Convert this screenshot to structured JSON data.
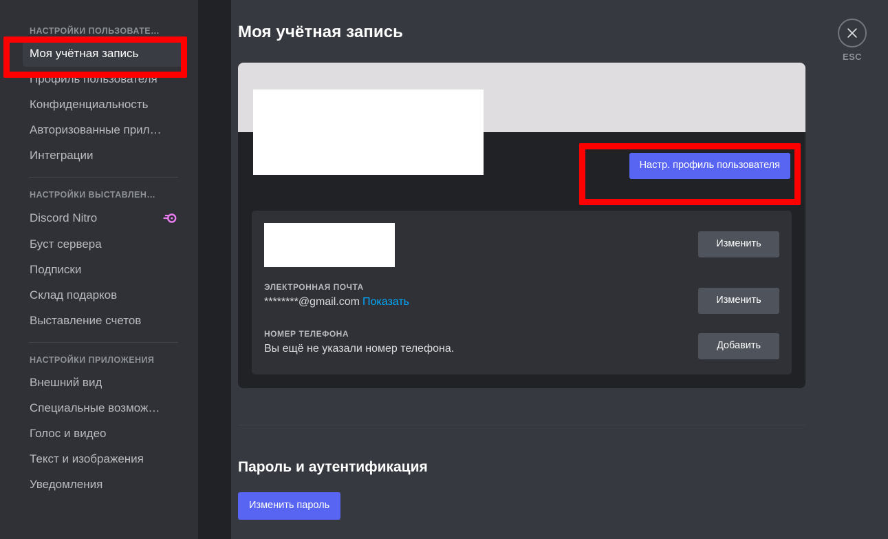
{
  "sidebar": {
    "groups": [
      {
        "header": "НАСТРОЙКИ ПОЛЬЗОВАТЕ…",
        "items": [
          {
            "label": "Моя учётная запись",
            "selected": true,
            "icon": ""
          },
          {
            "label": "Профиль пользователя",
            "selected": false,
            "icon": ""
          },
          {
            "label": "Конфиденциальность",
            "selected": false,
            "icon": ""
          },
          {
            "label": "Авторизованные прил…",
            "selected": false,
            "icon": ""
          },
          {
            "label": "Интеграции",
            "selected": false,
            "icon": ""
          }
        ]
      },
      {
        "header": "НАСТРОЙКИ ВЫСТАВЛЕН…",
        "items": [
          {
            "label": "Discord Nitro",
            "selected": false,
            "icon": "nitro-icon"
          },
          {
            "label": "Буст сервера",
            "selected": false,
            "icon": ""
          },
          {
            "label": "Подписки",
            "selected": false,
            "icon": ""
          },
          {
            "label": "Склад подарков",
            "selected": false,
            "icon": ""
          },
          {
            "label": "Выставление счетов",
            "selected": false,
            "icon": ""
          }
        ]
      },
      {
        "header": "НАСТРОЙКИ ПРИЛОЖЕНИЯ",
        "items": [
          {
            "label": "Внешний вид",
            "selected": false,
            "icon": ""
          },
          {
            "label": "Специальные возмож…",
            "selected": false,
            "icon": ""
          },
          {
            "label": "Голос и видео",
            "selected": false,
            "icon": ""
          },
          {
            "label": "Текст и изображения",
            "selected": false,
            "icon": ""
          },
          {
            "label": "Уведомления",
            "selected": false,
            "icon": ""
          }
        ]
      }
    ]
  },
  "header": {
    "title": "Моя учётная запись"
  },
  "close": {
    "icon": "close-icon",
    "label": "ESC"
  },
  "account_card": {
    "edit_profile_button": "Настр. профиль пользователя",
    "fields": [
      {
        "label": "",
        "value": "",
        "redacted": true,
        "button": "Изменить"
      },
      {
        "label": "ЭЛЕКТРОННАЯ ПОЧТА",
        "value": "********@gmail.com",
        "reveal": "Показать",
        "redacted": false,
        "button": "Изменить"
      },
      {
        "label": "НОМЕР ТЕЛЕФОНА",
        "value": "Вы ещё не указали номер телефона.",
        "redacted": false,
        "button": "Добавить"
      }
    ]
  },
  "password_section": {
    "title": "Пароль и аутентификация",
    "change_password_button": "Изменить пароль"
  },
  "colors": {
    "accent": "#5865f2",
    "link": "#00a8fc",
    "sidebar_bg": "#2f3136",
    "content_bg": "#36393f",
    "card_bg": "#202225",
    "panel_bg": "#2f3136",
    "secondary_button": "#4f545c",
    "annotation": "#ff0000",
    "nitro": "#ff73fa"
  }
}
